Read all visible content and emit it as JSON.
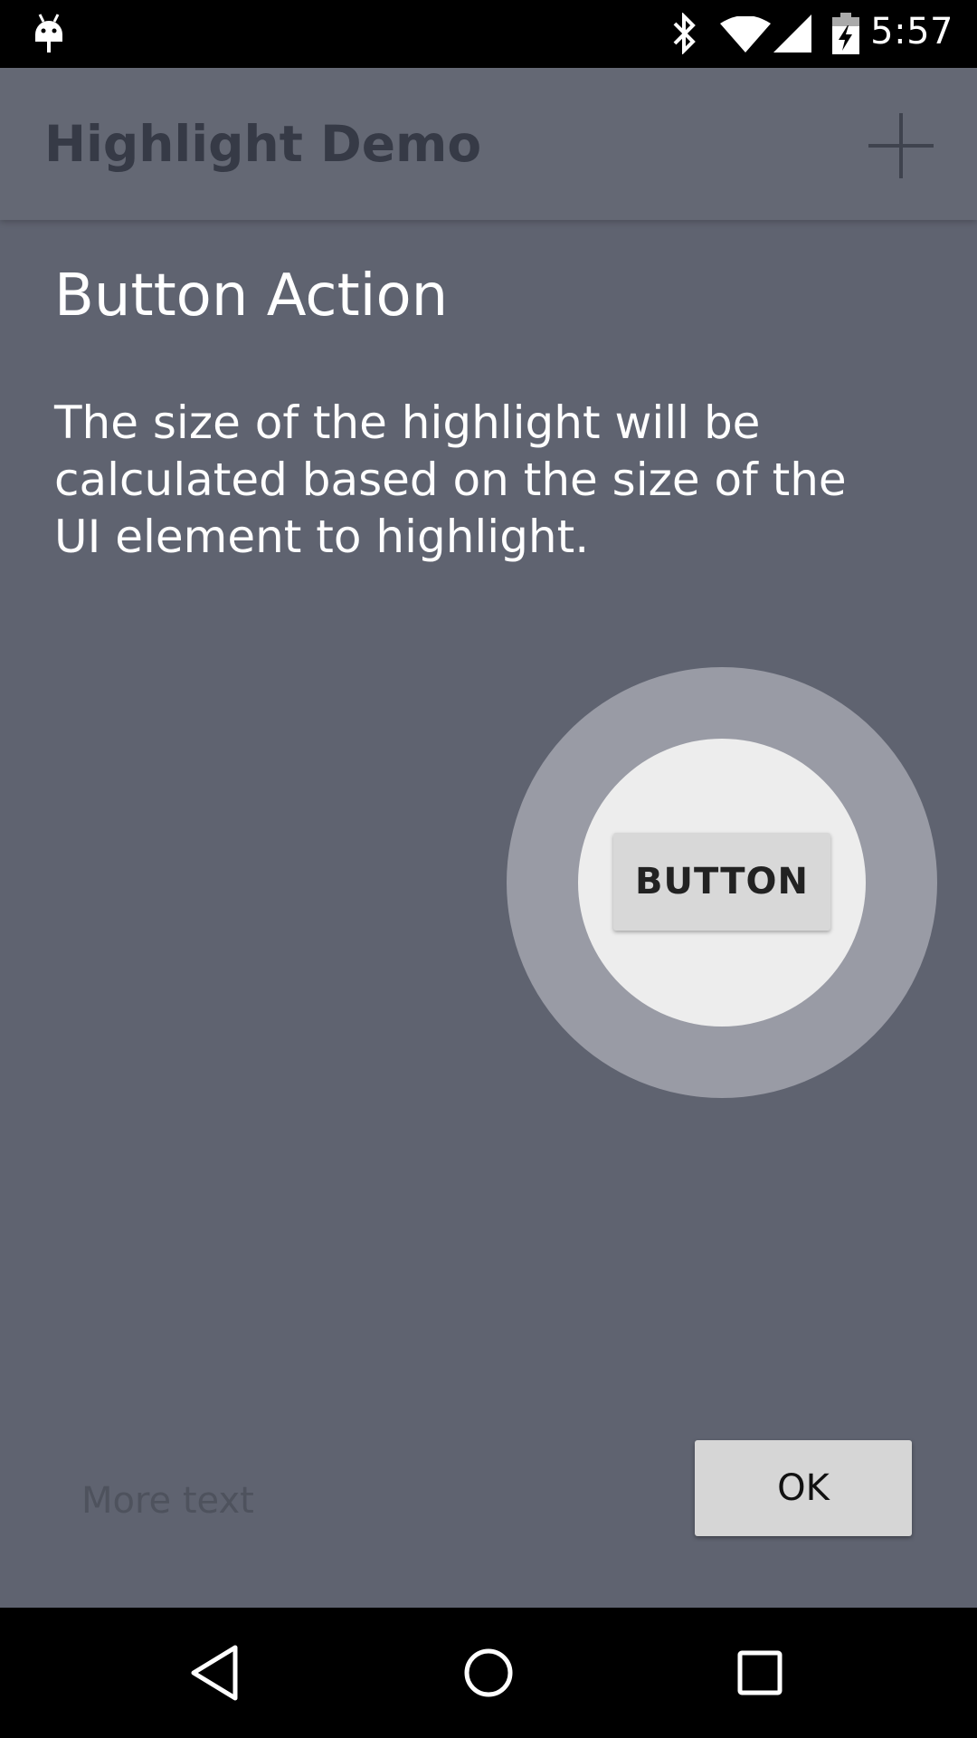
{
  "status_bar": {
    "time": "5:57",
    "icons": [
      "android-icon",
      "bluetooth-icon",
      "wifi-icon",
      "signal-icon",
      "battery-charging-icon"
    ]
  },
  "app_bar": {
    "title": "Highlight Demo",
    "action_icon": "add-icon"
  },
  "content": {
    "partial_text": "",
    "more_text": "More text",
    "button_label": "BUTTON"
  },
  "showcase": {
    "title": "Button Action",
    "description": "The size of the highlight will be calculated based on the size of the UI element to highlight.",
    "ok_label": "OK"
  },
  "nav_bar": {
    "icons": [
      "back-icon",
      "home-icon",
      "recents-icon"
    ]
  },
  "colors": {
    "overlay": "#5f6370",
    "outer_ring": "#999ba5",
    "inner_circle": "#ededed",
    "button": "#d8d8d8"
  }
}
